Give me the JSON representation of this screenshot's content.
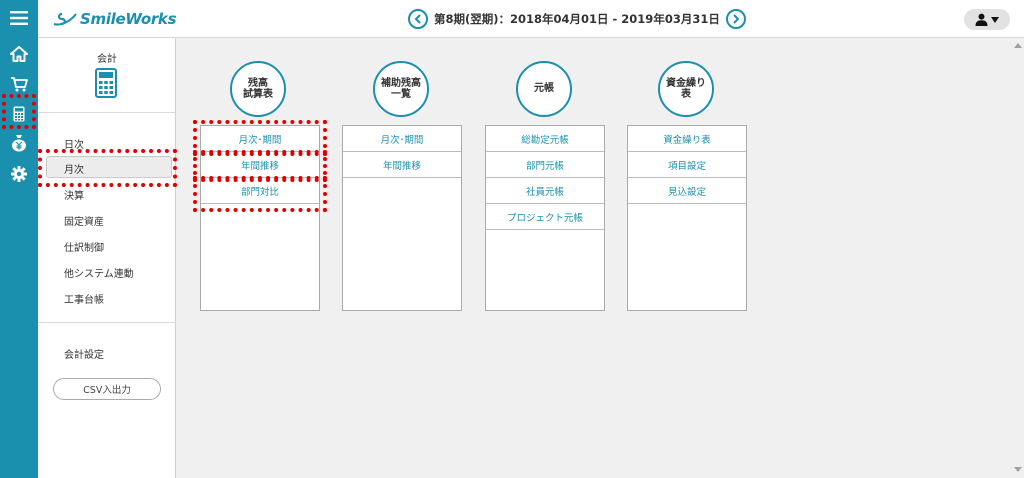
{
  "app": {
    "logo_text": "SmileWorks"
  },
  "header": {
    "period_label": "第8期(翌期)：2018年04月01日 - 2019年03月31日"
  },
  "rail": {
    "items": [
      {
        "icon": "menu-icon"
      },
      {
        "icon": "home-icon"
      },
      {
        "icon": "cart-icon"
      },
      {
        "icon": "calculator-icon"
      },
      {
        "icon": "yen-bag-icon"
      },
      {
        "icon": "gear-icon"
      }
    ]
  },
  "sidebar": {
    "title": "会計",
    "items": [
      {
        "label": "日次"
      },
      {
        "label": "月次"
      },
      {
        "label": "決算"
      },
      {
        "label": "固定資産"
      },
      {
        "label": "仕訳制御"
      },
      {
        "label": "他システム連動"
      },
      {
        "label": "工事台帳"
      }
    ],
    "settings_label": "会計設定",
    "csv_button": "CSV入出力"
  },
  "groups": [
    {
      "title": "残高\n試算表",
      "items": [
        "月次･期間",
        "年間推移",
        "部門対比"
      ]
    },
    {
      "title": "補助残高\n一覧",
      "items": [
        "月次･期間",
        "年間推移"
      ]
    },
    {
      "title": "元帳",
      "items": [
        "総勘定元帳",
        "部門元帳",
        "社員元帳",
        "プロジェクト元帳"
      ]
    },
    {
      "title": "資金繰り\n表",
      "items": [
        "資金繰り表",
        "項目設定",
        "見込設定"
      ]
    }
  ],
  "colors": {
    "brand": "#1a8fae",
    "highlight": "#e00000"
  }
}
